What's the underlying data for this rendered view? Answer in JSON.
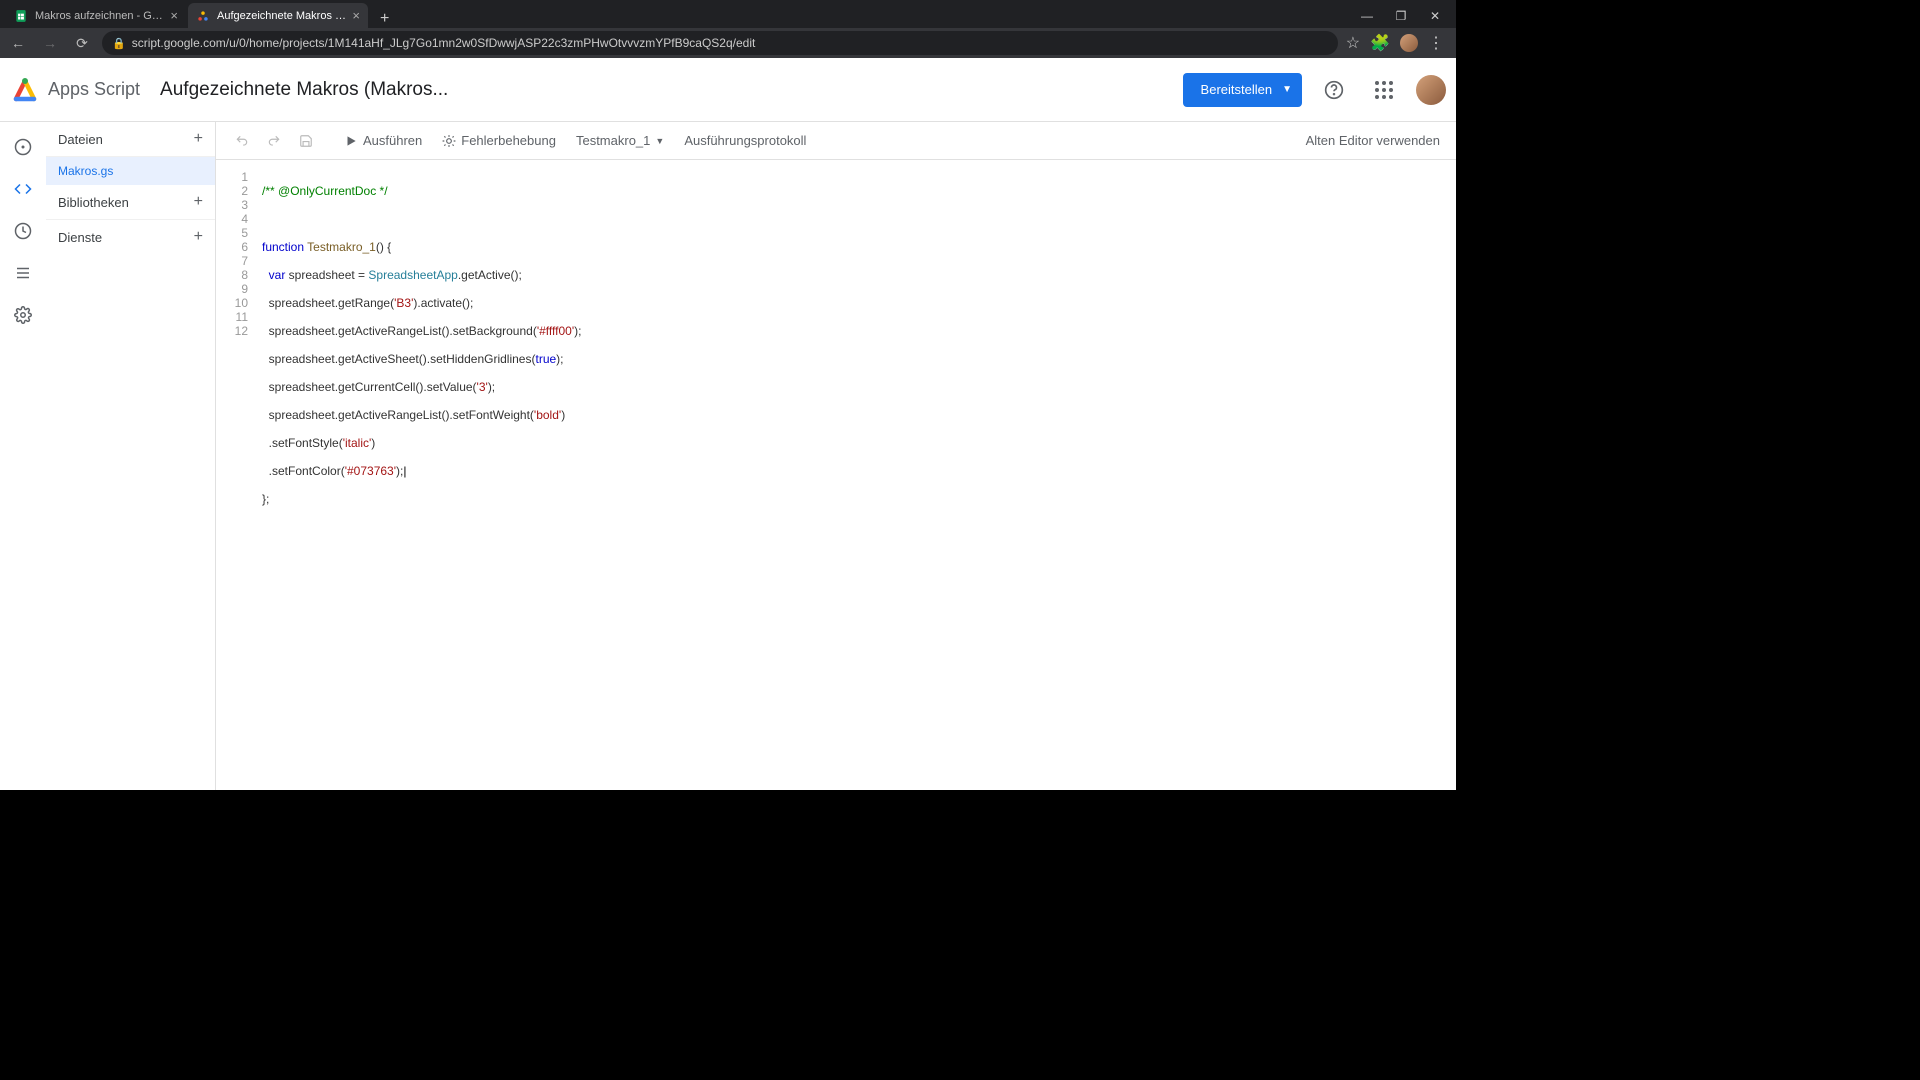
{
  "browser": {
    "tabs": [
      {
        "title": "Makros aufzeichnen - Google Ta"
      },
      {
        "title": "Aufgezeichnete Makros (Makros"
      }
    ],
    "url": "script.google.com/u/0/home/projects/1M141aHf_JLg7Go1mn2w0SfDwwjASP22c3zmPHwOtvvvzmYPfB9caQS2q/edit"
  },
  "header": {
    "product": "Apps Script",
    "project": "Aufgezeichnete Makros (Makros...",
    "deploy": "Bereitstellen",
    "legacy_editor": "Alten Editor verwenden"
  },
  "sidebar": {
    "sections": {
      "files": "Dateien",
      "libraries": "Bibliotheken",
      "services": "Dienste"
    },
    "file": "Makros.gs"
  },
  "toolbar": {
    "run": "Ausführen",
    "debug": "Fehlerbehebung",
    "fn_selected": "Testmakro_1",
    "log": "Ausführungsprotokoll"
  },
  "code": {
    "lines": [
      "1",
      "2",
      "3",
      "4",
      "5",
      "6",
      "7",
      "8",
      "9",
      "10",
      "11",
      "12"
    ],
    "l1_comment": "/** @OnlyCurrentDoc */",
    "l3_kw": "function",
    "l3_fn": "Testmakro_1",
    "l3_rest": "() {",
    "l4_kw": "var",
    "l4_var": " spreadsheet = ",
    "l4_type": "SpreadsheetApp",
    "l4_rest": ".getActive();",
    "l5": "  spreadsheet.getRange(",
    "l5_str": "'B3'",
    "l5_rest": ").activate();",
    "l6": "  spreadsheet.getActiveRangeList().setBackground(",
    "l6_str": "'#ffff00'",
    "l6_rest": ");",
    "l7": "  spreadsheet.getActiveSheet().setHiddenGridlines(",
    "l7_lit": "true",
    "l7_rest": ");",
    "l8": "  spreadsheet.getCurrentCell().setValue(",
    "l8_str": "'3'",
    "l8_rest": ");",
    "l9": "  spreadsheet.getActiveRangeList().setFontWeight(",
    "l9_str": "'bold'",
    "l9_rest": ")",
    "l10": "  .setFontStyle(",
    "l10_str": "'italic'",
    "l10_rest": ")",
    "l11": "  .setFontColor(",
    "l11_str": "'#073763'",
    "l11_rest": ");",
    "l12": "};"
  }
}
